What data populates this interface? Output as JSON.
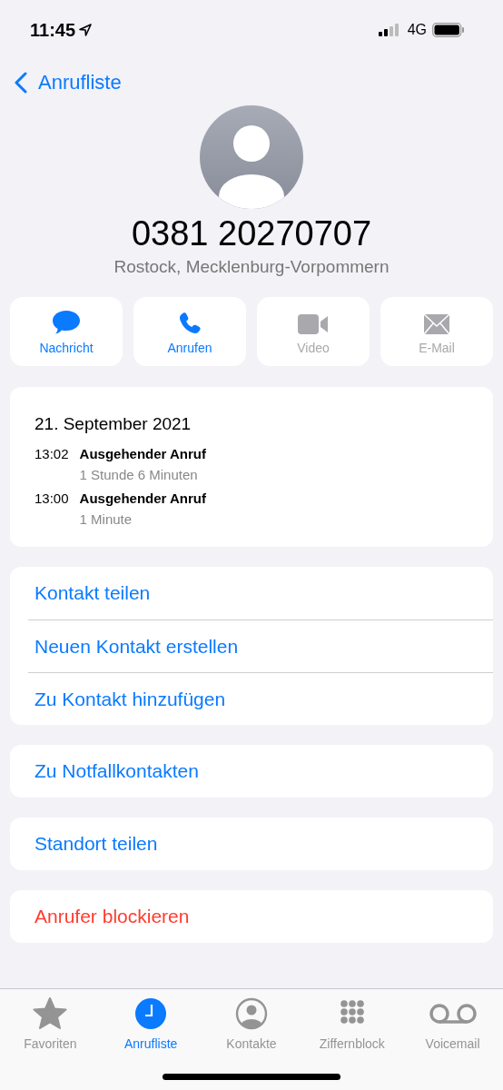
{
  "status_bar": {
    "time": "11:45",
    "network": "4G"
  },
  "nav": {
    "back": "Anrufliste"
  },
  "contact": {
    "number": "0381 20270707",
    "location": "Rostock, Mecklenburg-Vorpommern"
  },
  "actions": [
    {
      "kind": "message",
      "label": "Nachricht",
      "disabled": false
    },
    {
      "kind": "call",
      "label": "Anrufen",
      "disabled": false
    },
    {
      "kind": "video",
      "label": "Video",
      "disabled": true
    },
    {
      "kind": "mail",
      "label": "E-Mail",
      "disabled": true
    }
  ],
  "calls": {
    "date": "21. September 2021",
    "entries": [
      {
        "time": "13:02",
        "type": "Ausgehender Anruf",
        "duration": "1 Stunde 6 Minuten"
      },
      {
        "time": "13:00",
        "type": "Ausgehender Anruf",
        "duration": "1 Minute"
      }
    ]
  },
  "groups": [
    [
      {
        "label": "Kontakt teilen",
        "kind": "default"
      },
      {
        "label": "Neuen Kontakt erstellen",
        "kind": "default"
      },
      {
        "label": "Zu Kontakt hinzufügen",
        "kind": "default"
      }
    ],
    [
      {
        "label": "Zu Notfallkontakten",
        "kind": "default"
      }
    ],
    [
      {
        "label": "Standort teilen",
        "kind": "default"
      }
    ],
    [
      {
        "label": "Anrufer blockieren",
        "kind": "destructive"
      }
    ]
  ],
  "tab_bar": [
    {
      "kind": "favorites",
      "label": "Favoriten",
      "selected": false
    },
    {
      "kind": "recents",
      "label": "Anrufliste",
      "selected": true
    },
    {
      "kind": "contacts",
      "label": "Kontakte",
      "selected": false
    },
    {
      "kind": "keypad",
      "label": "Ziffernblock",
      "selected": false
    },
    {
      "kind": "voicemail",
      "label": "Voicemail",
      "selected": false
    }
  ]
}
